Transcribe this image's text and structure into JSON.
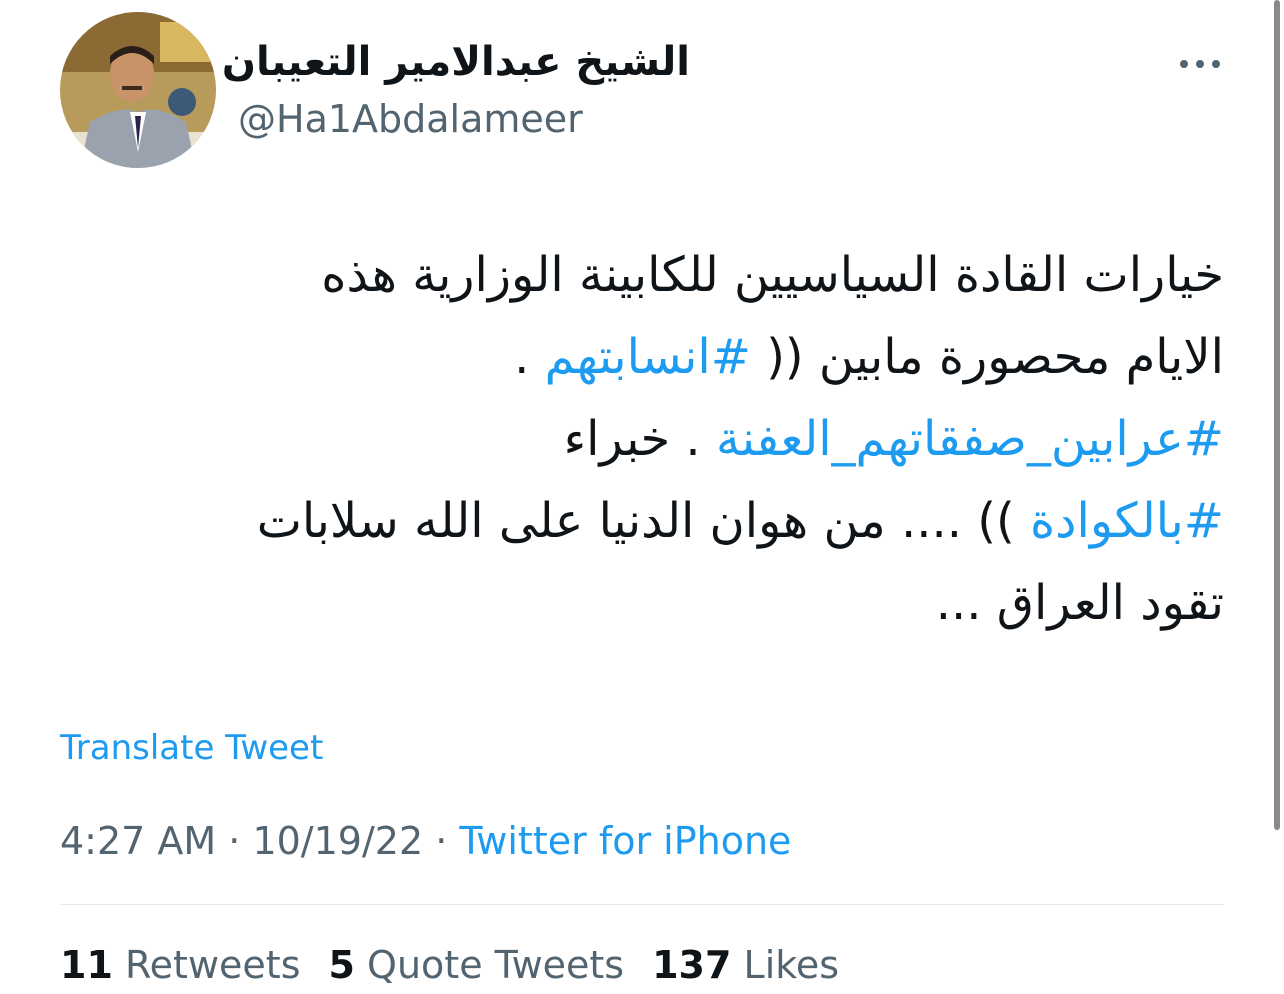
{
  "author": {
    "display_name": "الشيخ عبدالامير التعيبان",
    "handle": "@Ha1Abdalameer"
  },
  "tweet": {
    "lines": [
      [
        {
          "text": "خيارات القادة السياسيين للكابينة الوزارية هذه",
          "type": "text"
        }
      ],
      [
        {
          "text": "الايام محصورة مابين (( ",
          "type": "text"
        },
        {
          "text": "#انسابتهم",
          "type": "hashtag"
        },
        {
          "text": " .",
          "type": "text"
        }
      ],
      [
        {
          "text": "#عرابين_صفقاتهم_العفنة",
          "type": "hashtag"
        },
        {
          "text": "  . خبراء",
          "type": "text"
        }
      ],
      [
        {
          "text": "#بالكوادة",
          "type": "hashtag"
        },
        {
          "text": " )) .... من هوان الدنيا على الله سلابات",
          "type": "text"
        }
      ],
      [
        {
          "text": "تقود العراق ...",
          "type": "text"
        }
      ]
    ]
  },
  "translate_label": "Translate Tweet",
  "meta": {
    "time": "4:27 AM",
    "separator": " · ",
    "date": "10/19/22",
    "source": "Twitter for iPhone"
  },
  "stats": {
    "retweets": {
      "count": "11",
      "label": "Retweets"
    },
    "quote_tweets": {
      "count": "5",
      "label": "Quote Tweets"
    },
    "likes": {
      "count": "137",
      "label": "Likes"
    }
  },
  "colors": {
    "accent": "#1d9bf0",
    "text_primary": "#0f1419",
    "text_secondary": "#536471"
  },
  "icons": {
    "more": "more-horizontal-icon"
  }
}
